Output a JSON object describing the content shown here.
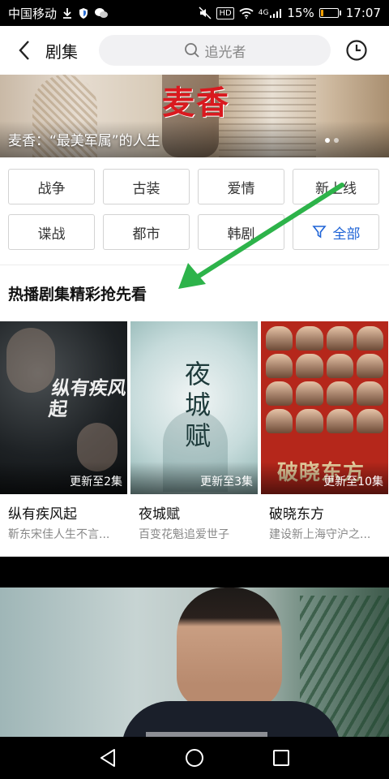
{
  "status_bar": {
    "carrier": "中国移动",
    "battery_percent": "15%",
    "time": "17:07",
    "network": "4G",
    "hd": "HD"
  },
  "header": {
    "title": "剧集",
    "search_placeholder": "追光者"
  },
  "banner": {
    "logo": "麦香",
    "caption": "麦香：“最美军属”的人生"
  },
  "categories": [
    "战争",
    "古装",
    "爱情",
    "新上线",
    "谍战",
    "都市",
    "韩剧",
    "全部"
  ],
  "section_title": "热播剧集精彩抢先看",
  "shows": [
    {
      "name": "纵有疾风起",
      "desc": "靳东宋佳人生不言...",
      "update": "更新至2集",
      "poster_text": "纵有疾风起"
    },
    {
      "name": "夜城赋",
      "desc": "百变花魁追爱世子",
      "update": "更新至3集",
      "poster_text": "夜城赋"
    },
    {
      "name": "破晓东方",
      "desc": "建设新上海守沪之...",
      "update": "更新至10集",
      "poster_text": "破晓东方"
    }
  ],
  "colors": {
    "accent": "#1e63d6",
    "annotation_arrow": "#2db34a",
    "logo_red": "#d9191f"
  }
}
